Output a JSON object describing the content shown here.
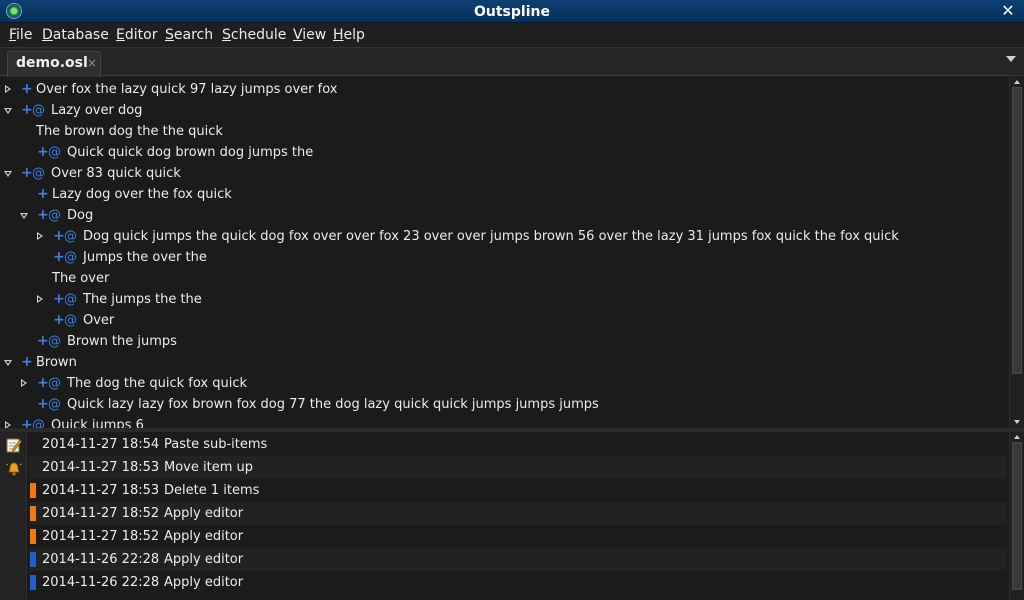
{
  "window": {
    "title": "Outspline"
  },
  "menubar": [
    {
      "label": "File",
      "u": "F",
      "rest": "ile"
    },
    {
      "label": "Database",
      "u": "D",
      "rest": "atabase"
    },
    {
      "label": "Editor",
      "u": "E",
      "rest": "ditor"
    },
    {
      "label": "Search",
      "u": "S",
      "rest": "earch"
    },
    {
      "label": "Schedule",
      "u": "S",
      "rest": "chedule"
    },
    {
      "label": "View",
      "u": "V",
      "rest": "iew"
    },
    {
      "label": "Help",
      "u": "H",
      "rest": "elp"
    }
  ],
  "tabs": [
    {
      "label": "demo.osl",
      "close": "×"
    }
  ],
  "tree": [
    {
      "depth": 0,
      "exp": "collapsed",
      "plus": true,
      "at": false,
      "text": "Over fox the lazy quick 97 lazy jumps over fox"
    },
    {
      "depth": 0,
      "exp": "expanded",
      "plus": true,
      "at": true,
      "text": "Lazy over dog"
    },
    {
      "depth": 1,
      "exp": "none",
      "plus": false,
      "at": false,
      "text": "The brown dog the the quick"
    },
    {
      "depth": 1,
      "exp": "none",
      "plus": true,
      "at": true,
      "text": "Quick quick dog brown dog jumps the"
    },
    {
      "depth": 0,
      "exp": "expanded",
      "plus": true,
      "at": true,
      "text": "Over 83 quick quick"
    },
    {
      "depth": 1,
      "exp": "none",
      "plus": true,
      "at": false,
      "text": "Lazy dog over the fox quick"
    },
    {
      "depth": 1,
      "exp": "expanded",
      "plus": true,
      "at": true,
      "text": "Dog"
    },
    {
      "depth": 2,
      "exp": "collapsed",
      "plus": true,
      "at": true,
      "text": "Dog quick jumps the quick dog fox over over fox 23 over over jumps brown 56 over the lazy 31 jumps fox quick the fox quick"
    },
    {
      "depth": 2,
      "exp": "none",
      "plus": true,
      "at": true,
      "text": "Jumps the over the"
    },
    {
      "depth": 2,
      "exp": "none",
      "plus": false,
      "at": false,
      "text": "The over"
    },
    {
      "depth": 2,
      "exp": "collapsed",
      "plus": true,
      "at": true,
      "text": "The jumps the the"
    },
    {
      "depth": 2,
      "exp": "none",
      "plus": true,
      "at": true,
      "text": "Over"
    },
    {
      "depth": 1,
      "exp": "none",
      "plus": true,
      "at": true,
      "text": "Brown the jumps"
    },
    {
      "depth": 0,
      "exp": "expanded",
      "plus": true,
      "at": false,
      "text": "Brown"
    },
    {
      "depth": 1,
      "exp": "collapsed",
      "plus": true,
      "at": true,
      "text": "The dog the quick fox quick"
    },
    {
      "depth": 1,
      "exp": "none",
      "plus": true,
      "at": true,
      "text": "Quick lazy lazy fox brown fox dog 77 the dog lazy quick quick jumps jumps jumps"
    },
    {
      "depth": 0,
      "exp": "collapsed",
      "plus": true,
      "at": true,
      "text": "Quick jumps 6"
    }
  ],
  "log": [
    {
      "time": "2014-11-27 18:54",
      "action": "Paste sub-items",
      "marker": ""
    },
    {
      "time": "2014-11-27 18:53",
      "action": "Move item up",
      "marker": ""
    },
    {
      "time": "2014-11-27 18:53",
      "action": "Delete 1 items",
      "marker": "#f07a10"
    },
    {
      "time": "2014-11-27 18:52",
      "action": "Apply editor",
      "marker": "#f07a10"
    },
    {
      "time": "2014-11-27 18:52",
      "action": "Apply editor",
      "marker": "#f07a10"
    },
    {
      "time": "2014-11-26 22:28",
      "action": "Apply editor",
      "marker": "#1f5fc8"
    },
    {
      "time": "2014-11-26 22:28",
      "action": "Apply editor",
      "marker": "#1f5fc8"
    }
  ],
  "sidebar_icons": [
    {
      "name": "edit-history-icon"
    },
    {
      "name": "bell-alarm-icon"
    }
  ],
  "colors": {
    "accent": "#3d7fe0",
    "titlebar": "#0d3f74",
    "undo_marker": "#f07a10",
    "redo_marker": "#1f5fc8"
  }
}
